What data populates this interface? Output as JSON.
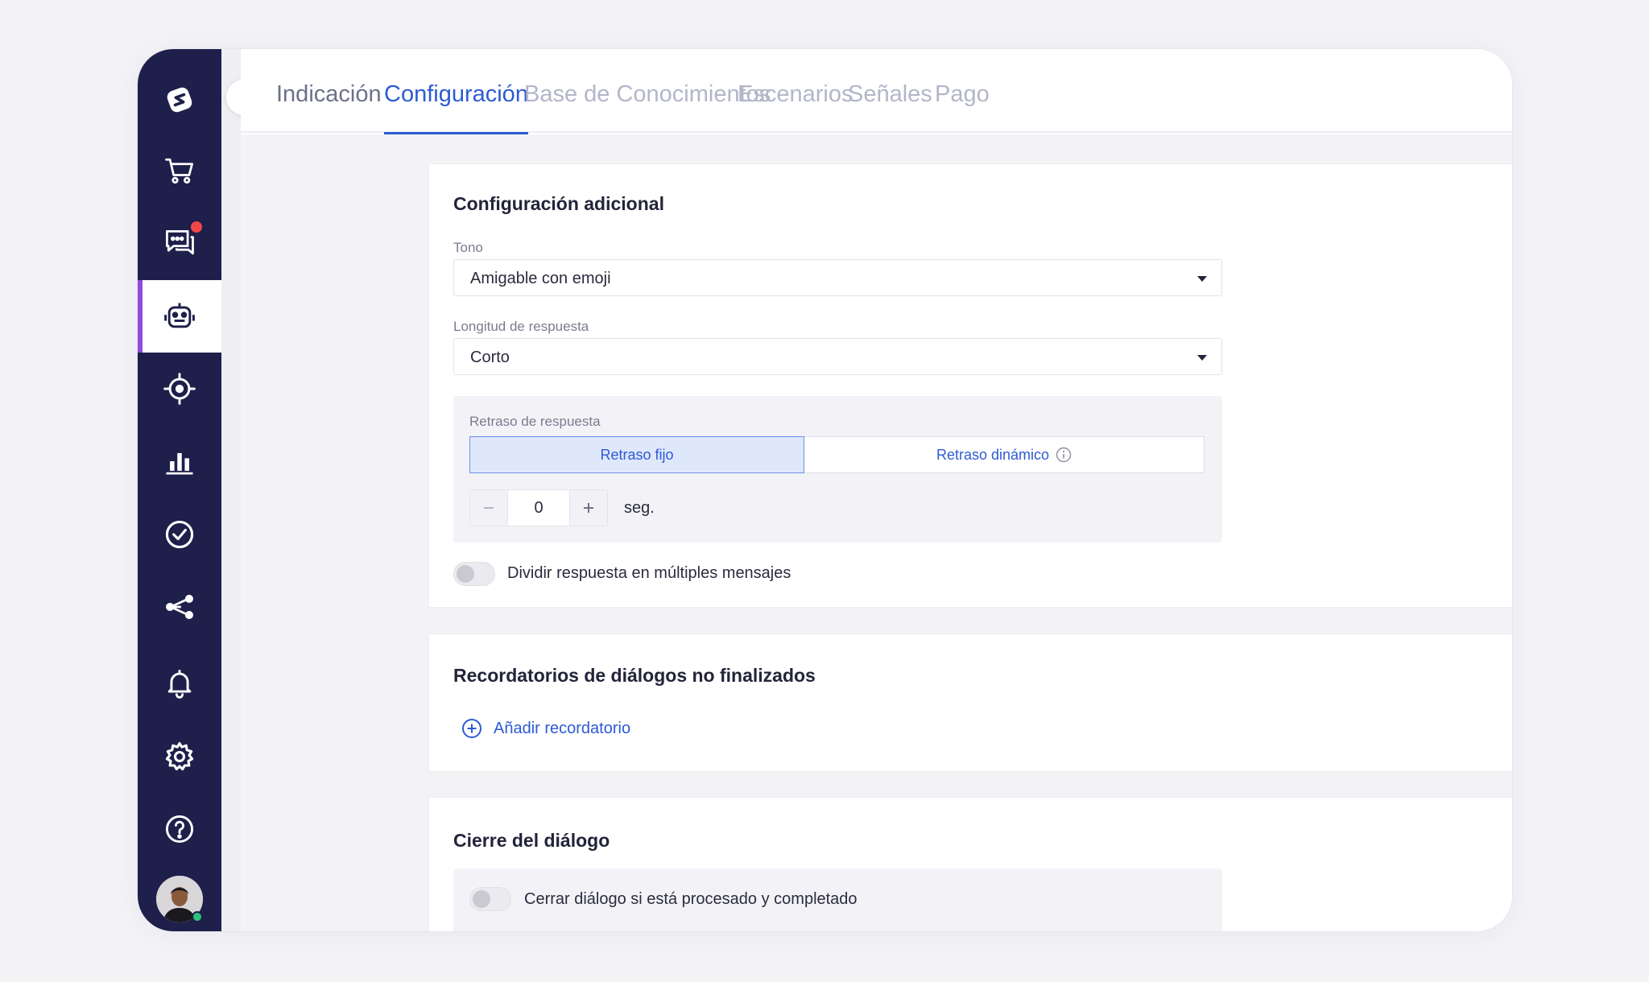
{
  "tabs": [
    {
      "label": "Indicación"
    },
    {
      "label": "Configuración"
    },
    {
      "label": "Base de Conocimientos"
    },
    {
      "label": "Escenarios"
    },
    {
      "label": "Señales"
    },
    {
      "label": "Pago"
    }
  ],
  "active_tab": "Configuración",
  "sidebar": {
    "items": [
      "logo-icon",
      "cart-icon",
      "chat-icon",
      "robot-icon",
      "target-icon",
      "chart-icon",
      "check-circle-icon",
      "share-icon",
      "bell-icon",
      "gear-icon",
      "help-icon"
    ],
    "active": "robot-icon",
    "accent": "#8f4be0",
    "background": "#1e1f4b"
  },
  "additional": {
    "title": "Configuración adicional",
    "tone_label": "Tono",
    "tone_value": "Amigable con emoji",
    "length_label": "Longitud de respuesta",
    "length_value": "Corto",
    "delay_label": "Retraso de respuesta",
    "fixed_delay": "Retraso fijo",
    "dynamic_delay": "Retraso dinámico",
    "delay_value": "0",
    "delay_unit": "seg.",
    "split_label": "Dividir respuesta en múltiples mensajes"
  },
  "reminders": {
    "title": "Recordatorios de diálogos no finalizados",
    "add_label": "Añadir recordatorio"
  },
  "closing": {
    "title": "Cierre del diálogo",
    "close_label": "Cerrar diálogo si está procesado y completado"
  },
  "colors": {
    "primary": "#2d5bd4",
    "notification": "#f04848",
    "online": "#2fc27a"
  }
}
